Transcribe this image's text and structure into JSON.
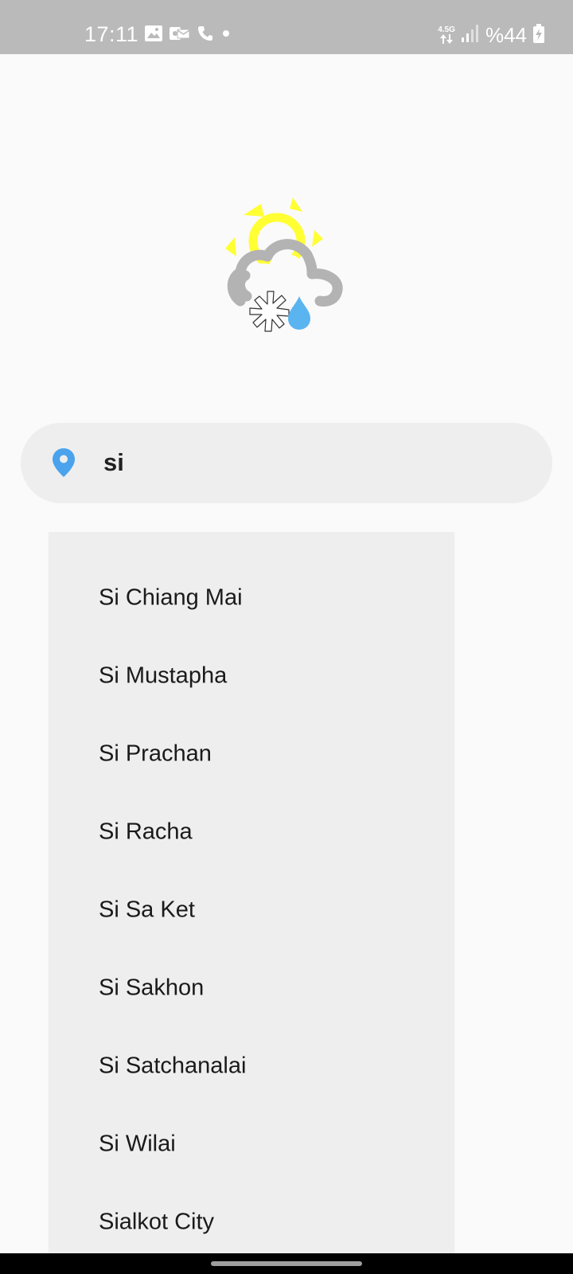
{
  "status_bar": {
    "time": "17:11",
    "left_icons": [
      "image-icon",
      "voicemail-icon",
      "phone-icon",
      "dot-icon"
    ],
    "network_type": "4.5G",
    "battery": "%44",
    "color": "#ffffff",
    "background": "#bababa"
  },
  "logo": {
    "icon": "weather-sun-cloud-snow-rain-icon",
    "colors": {
      "sun": "#ffff33",
      "cloud": "#b3b3b3",
      "rain": "#5ab4f0"
    }
  },
  "search": {
    "value": "si",
    "icon": "location-pin-icon",
    "icon_color": "#4aa3ec"
  },
  "suggestions": [
    "Si Chiang Mai",
    "Si Mustapha",
    "Si Prachan",
    "Si Racha",
    "Si Sa Ket",
    "Si Sakhon",
    "Si Satchanalai",
    "Si Wilai",
    "Sialkot City"
  ]
}
